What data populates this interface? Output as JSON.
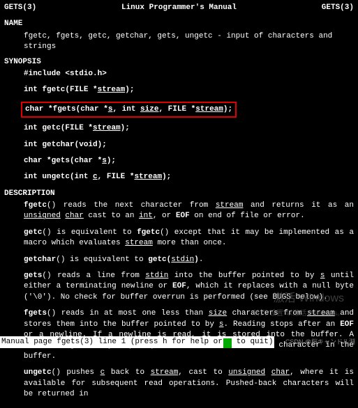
{
  "header": {
    "left": "GETS(3)",
    "center": "Linux Programmer's Manual",
    "right": "GETS(3)"
  },
  "sections": {
    "name_title": "NAME",
    "name_text": "fgetc, fgets, getc, getchar, gets, ungetc - input of characters and strings",
    "synopsis_title": "SYNOPSIS",
    "include": "#include <stdio.h>",
    "fgetc_pre": "int fgetc(FILE *",
    "fgetc_u": "stream",
    "fgetc_post": ");",
    "fgets_pre": "char *fgets(char *",
    "fgets_u1": "s",
    "fgets_mid1": ", int ",
    "fgets_u2": "size",
    "fgets_mid2": ", FILE *",
    "fgets_u3": "stream",
    "fgets_post": ");",
    "getc_pre": "int getc(FILE *",
    "getc_u": "stream",
    "getc_post": ");",
    "getchar": "int getchar(void);",
    "gets_pre": "char *gets(char *",
    "gets_u": "s",
    "gets_post": ");",
    "ungetc_pre": "int ungetc(int ",
    "ungetc_u1": "c",
    "ungetc_mid": ", FILE *",
    "ungetc_u2": "stream",
    "ungetc_post": ");",
    "desc_title": "DESCRIPTION"
  },
  "desc": {
    "p1a": "fgetc",
    "p1b": "()  reads  the next character from ",
    "p1c": "stream",
    "p1d": " and returns it as an ",
    "p1e": "unsigned",
    "p1sp": "  ",
    "p1f": "char",
    "p1g": " cast to an ",
    "p1h": "int",
    "p1i": ", or ",
    "p1j": "EOF",
    "p1k": " on end of file or error.",
    "p2a": "getc",
    "p2b": "() is equivalent to ",
    "p2c": "fgetc",
    "p2d": "() except that it may  be  implemented  as  a  macro which evaluates ",
    "p2e": "stream",
    "p2f": " more than once.",
    "p3a": "getchar",
    "p3b": "() is equivalent to ",
    "p3c": "getc(",
    "p3d": "stdin",
    "p3e": ")",
    "p3f": ".",
    "p4a": "gets",
    "p4b": "()  reads  a  line  from ",
    "p4c": "stdin",
    "p4d": " into the buffer pointed to by ",
    "p4e": "s",
    "p4f": " until either a terminating newline or ",
    "p4g": "EOF",
    "p4h": ", which it replaces with a null byte ('\\0').  No  check for buffer overrun is performed (see BUGS below).",
    "p5a": "fgets",
    "p5b": "()  reads  in  at  most one less than ",
    "p5c": "size",
    "p5d": " characters from ",
    "p5e": "stream",
    "p5f": " and stores them into the buffer pointed to by ",
    "p5g": "s",
    "p5h": ".  Reading stops after an ",
    "p5i": "EOF",
    "p5j": " or  a  newline.  If  a  newline  is  read,  it is stored into the buffer.  A terminating null byte ('\\0') is stored after the last character in the buffer.",
    "p6a": "ungetc",
    "p6b": "() pushes ",
    "p6c": "c",
    "p6d": " back to ",
    "p6e": "stream",
    "p6f": ", cast to ",
    "p6g": "unsigned",
    "p6sp": "  ",
    "p6h": "char",
    "p6i": ",  where  it  is  available for  subsequent  read  operations.   Pushed-back  characters  will be returned in"
  },
  "status": " Manual page fgets(3) line 1 (press h for help or q to quit)",
  "watermark1": "激活 Windows",
  "watermark2": "转到\"设置\"以激活 Windows。",
  "csdn": "CSDN @桜キャンドル淵"
}
